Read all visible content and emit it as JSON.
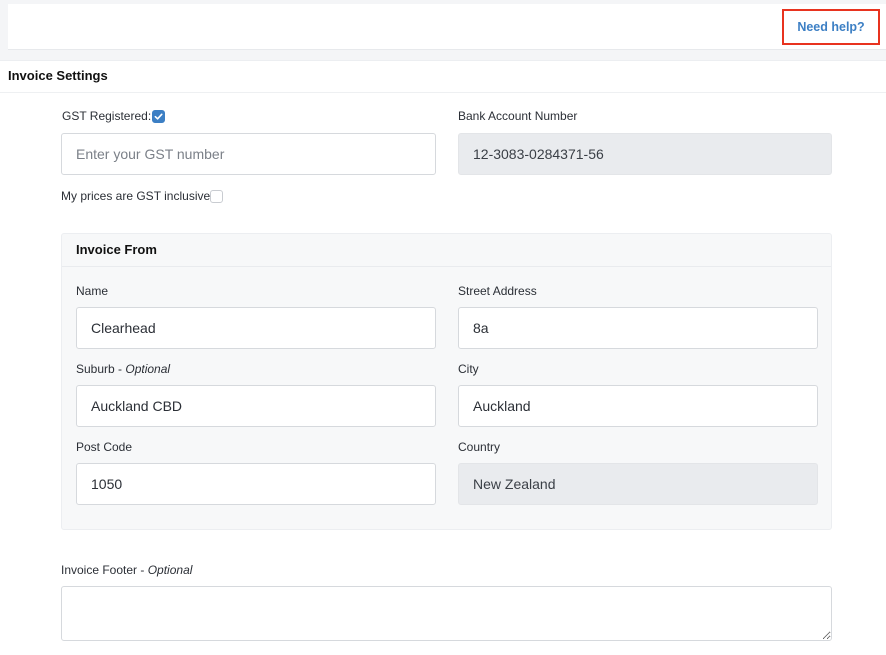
{
  "header": {
    "help_link": "Need help?"
  },
  "settings": {
    "title": "Invoice Settings",
    "gst_registered_label": "GST Registered:",
    "gst_registered_checked": true,
    "gst_number_placeholder": "Enter your GST number",
    "gst_number_value": "",
    "bank_account_label": "Bank Account Number",
    "bank_account_value": "12-3083-0284371-56",
    "gst_inclusive_label": "My prices are GST inclusive",
    "gst_inclusive_checked": false,
    "footer_label": "Invoice Footer",
    "footer_optional": "Optional",
    "footer_value": ""
  },
  "invoice_from": {
    "title": "Invoice From",
    "name_label": "Name",
    "name_value": "Clearhead",
    "street_label": "Street Address",
    "street_value": "8a",
    "suburb_label": "Suburb",
    "suburb_optional": "Optional",
    "suburb_value": "Auckland CBD",
    "city_label": "City",
    "city_value": "Auckland",
    "postcode_label": "Post Code",
    "postcode_value": "1050",
    "country_label": "Country",
    "country_value": "New Zealand"
  },
  "colors": {
    "accent": "#3c7fc4",
    "highlight_border": "#e8331f",
    "disabled_field": "#e9ebee"
  }
}
